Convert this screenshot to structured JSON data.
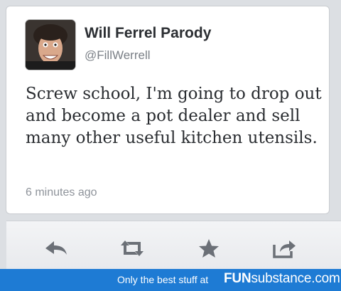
{
  "tweet": {
    "display_name": "Will Ferrel Parody",
    "handle": "@FillWerrell",
    "text": "Screw school, I'm going to drop out and become a pot dealer and sell many other useful kitchen utensils.",
    "timestamp": "6 minutes ago",
    "avatar_icon": "person-photo"
  },
  "actions": [
    {
      "name": "reply",
      "icon": "reply-arrow-icon"
    },
    {
      "name": "retweet",
      "icon": "retweet-icon"
    },
    {
      "name": "favorite",
      "icon": "star-icon"
    },
    {
      "name": "share",
      "icon": "share-icon"
    }
  ],
  "footer": {
    "tagline": "Only the best stuff at",
    "brand_bold": "FUN",
    "brand_rest": "substance.com"
  },
  "colors": {
    "background": "#dcdfe3",
    "card": "#ffffff",
    "action_icon": "#6b7077",
    "footer": "#1e7bd4"
  }
}
